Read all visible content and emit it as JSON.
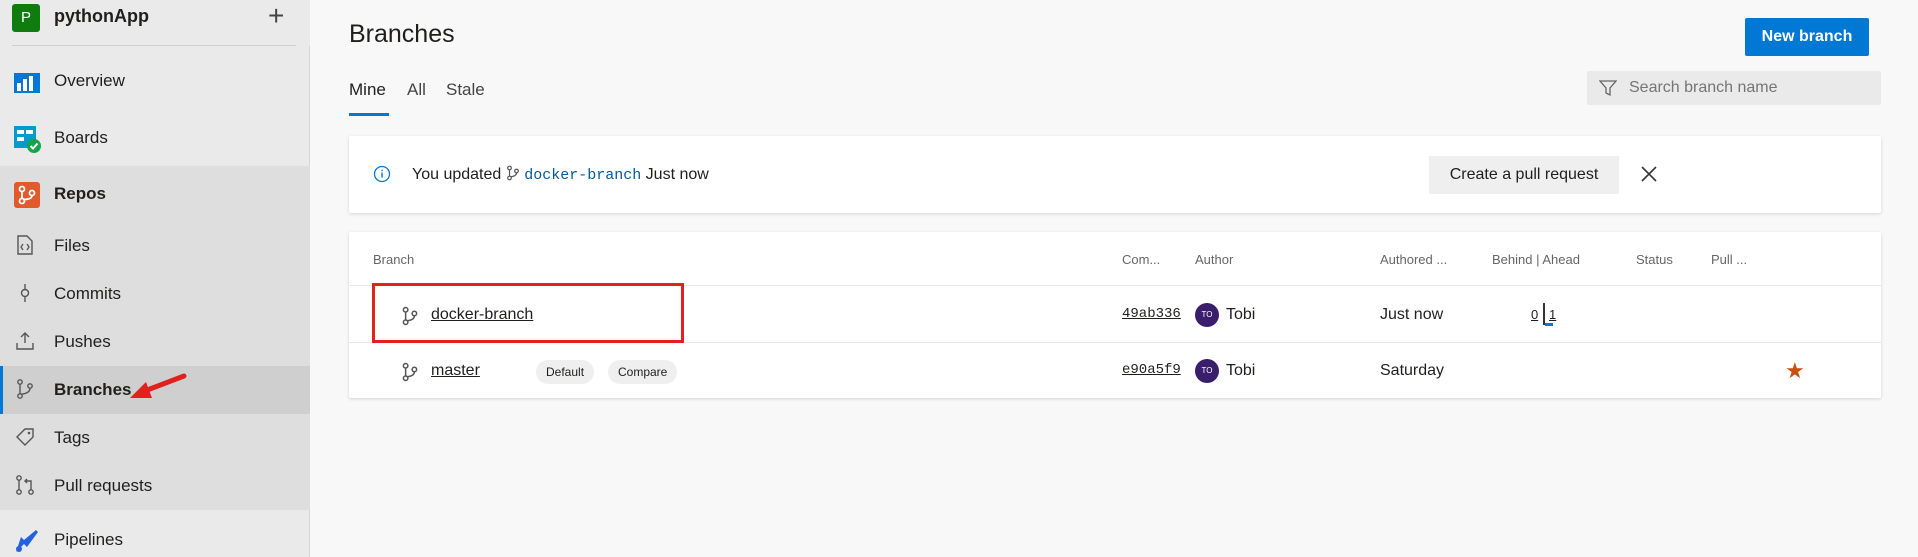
{
  "project": {
    "initial": "P",
    "name": "pythonApp",
    "add_glyph": "+"
  },
  "nav": {
    "overview": "Overview",
    "boards": "Boards",
    "repos": "Repos",
    "files": "Files",
    "commits": "Commits",
    "pushes": "Pushes",
    "branches": "Branches",
    "tags": "Tags",
    "pull_requests": "Pull requests",
    "pipelines": "Pipelines"
  },
  "page": {
    "title": "Branches",
    "new_branch_label": "New branch",
    "tabs": [
      "Mine",
      "All",
      "Stale"
    ],
    "search_placeholder": "Search branch name"
  },
  "banner": {
    "prefix": "You updated",
    "branch": "docker-branch",
    "suffix": "Just now",
    "pr_label": "Create a pull request"
  },
  "table": {
    "headers": [
      "Branch",
      "Com...",
      "Author",
      "Authored ...",
      "Behind | Ahead",
      "Status",
      "Pull ..."
    ],
    "rows": [
      {
        "branch": "docker-branch",
        "commit": "49ab336",
        "author_initials": "TO",
        "author": "Tobi",
        "authored": "Just now",
        "behind": "0",
        "ahead": "1"
      },
      {
        "branch": "master",
        "tags": [
          "Default",
          "Compare"
        ],
        "commit": "e90a5f9",
        "author_initials": "TO",
        "author": "Tobi",
        "authored": "Saturday",
        "favorite": "★"
      }
    ]
  },
  "colors": {
    "accent": "#0078d4",
    "highlight": "#e0211d",
    "star": "#ca5010",
    "project_badge": "#107c10"
  }
}
